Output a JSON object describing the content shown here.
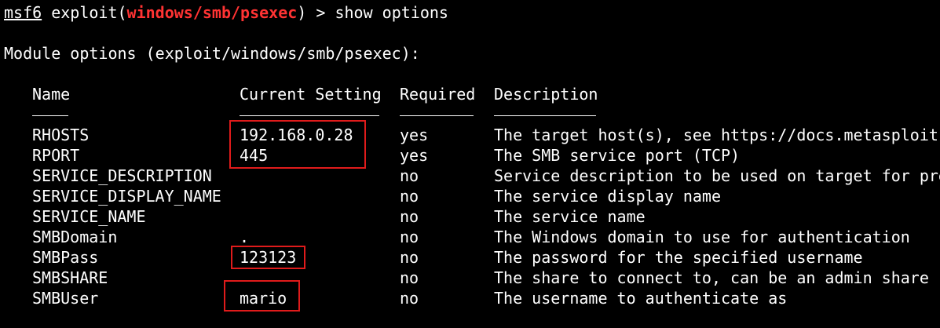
{
  "prompt": {
    "prefix": "msf6",
    "cmd_open": " exploit(",
    "module": "windows/smb/psexec",
    "cmd_close": ") > ",
    "command": "show options"
  },
  "module_header": "Module options (exploit/windows/smb/psexec):",
  "columns": {
    "name": "Name",
    "current_setting": "Current Setting",
    "required": "Required",
    "description": "Description"
  },
  "rows": [
    {
      "name": "RHOSTS",
      "setting": "192.168.0.28",
      "required": "yes",
      "description": "The target host(s), see https://docs.metasploit"
    },
    {
      "name": "RPORT",
      "setting": "445",
      "required": "yes",
      "description": "The SMB service port (TCP)"
    },
    {
      "name": "SERVICE_DESCRIPTION",
      "setting": "",
      "required": "no",
      "description": "Service description to be used on target for pre"
    },
    {
      "name": "SERVICE_DISPLAY_NAME",
      "setting": "",
      "required": "no",
      "description": "The service display name"
    },
    {
      "name": "SERVICE_NAME",
      "setting": "",
      "required": "no",
      "description": "The service name"
    },
    {
      "name": "SMBDomain",
      "setting": ".",
      "required": "no",
      "description": "The Windows domain to use for authentication"
    },
    {
      "name": "SMBPass",
      "setting": "123123",
      "required": "no",
      "description": "The password for the specified username"
    },
    {
      "name": "SMBSHARE",
      "setting": "",
      "required": "no",
      "description": "The share to connect to, can be an admin share ("
    },
    {
      "name": "SMBUser",
      "setting": "mario",
      "required": "no",
      "description": "The username to authenticate as"
    }
  ],
  "colors": {
    "background": "#000000",
    "text": "#ffffff",
    "module_red": "#ff3333",
    "highlight_box": "#e01b1b"
  }
}
